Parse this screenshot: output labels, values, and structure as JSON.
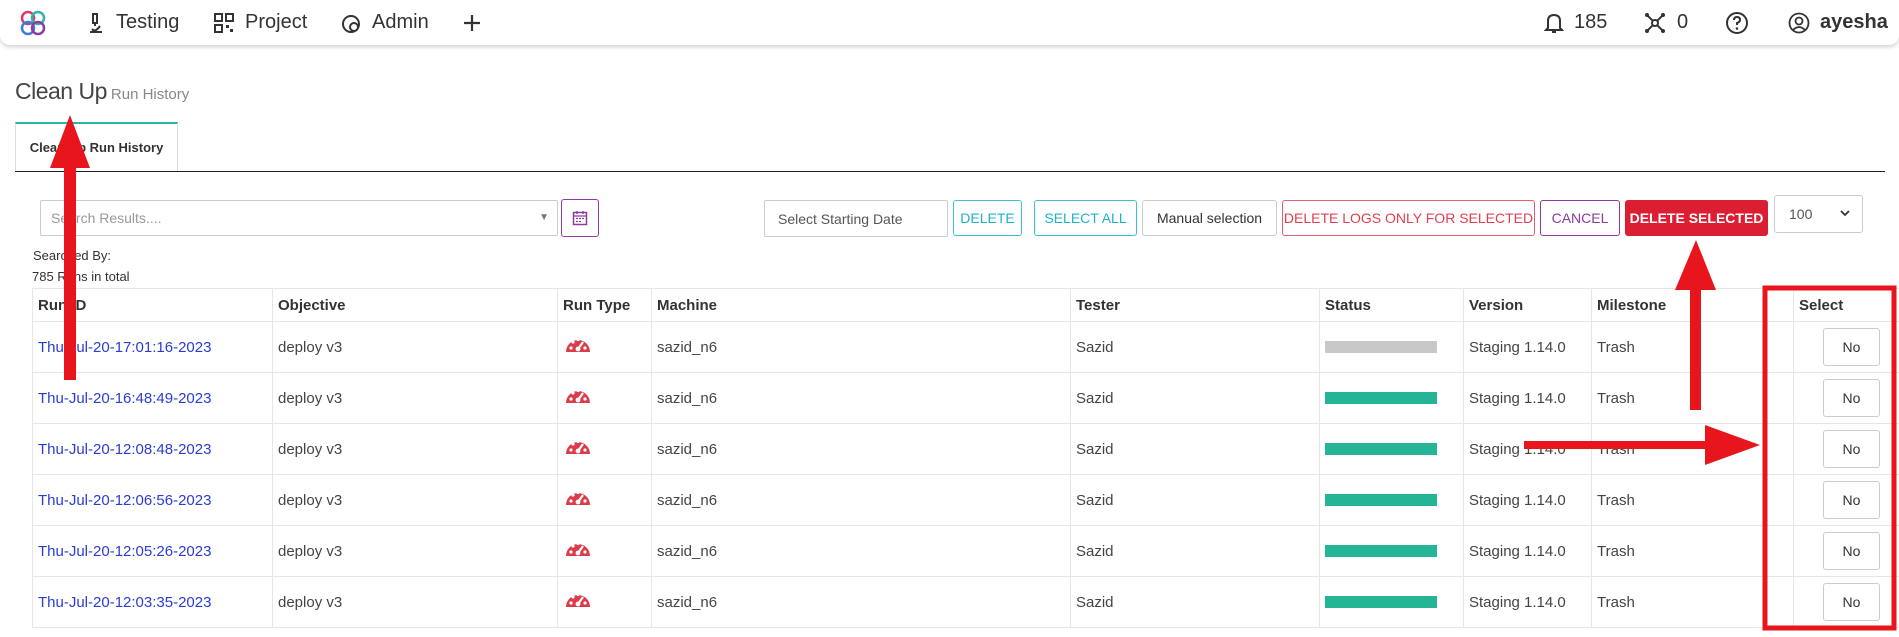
{
  "nav": {
    "items": [
      {
        "label": "Testing",
        "icon": "microscope-icon"
      },
      {
        "label": "Project",
        "icon": "qr-grid-icon"
      },
      {
        "label": "Admin",
        "icon": "gear-shield-icon"
      }
    ],
    "notifications_count": "185",
    "graph_count": "0",
    "username": "ayesha"
  },
  "page": {
    "title": "Clean Up",
    "subtitle": "Run History",
    "tab_label": "Clean Up Run History"
  },
  "toolbar": {
    "search_placeholder": "Search Results....",
    "date_placeholder": "Select Starting Date",
    "delete_label": "DELETE",
    "select_all_label": "SELECT ALL",
    "manual_selection_label": "Manual selection",
    "delete_logs_label": "DELETE LOGS ONLY FOR SELECTED",
    "cancel_label": "CANCEL",
    "delete_selected_label": "DELETE SELECTED",
    "page_size": "100"
  },
  "summary": {
    "searched_by": "Searched By:",
    "total": "785 Runs in total"
  },
  "table": {
    "columns": [
      "Run ID",
      "Objective",
      "Run Type",
      "Machine",
      "Tester",
      "Status",
      "Version",
      "Milestone",
      "Select"
    ],
    "rows": [
      {
        "run_id": "Thu-Jul-20-17:01:16-2023",
        "objective": "deploy v3",
        "machine": "sazid_n6",
        "tester": "Sazid",
        "status": "in-progress",
        "status_color": "#c8c8c8",
        "version": "Staging 1.14.0",
        "milestone": "Trash",
        "select": "No"
      },
      {
        "run_id": "Thu-Jul-20-16:48:49-2023",
        "objective": "deploy v3",
        "machine": "sazid_n6",
        "tester": "Sazid",
        "status": "passed",
        "status_color": "#26b496",
        "version": "Staging 1.14.0",
        "milestone": "Trash",
        "select": "No"
      },
      {
        "run_id": "Thu-Jul-20-12:08:48-2023",
        "objective": "deploy v3",
        "machine": "sazid_n6",
        "tester": "Sazid",
        "status": "passed",
        "status_color": "#26b496",
        "version": "Staging 1.14.0",
        "milestone": "Trash",
        "select": "No"
      },
      {
        "run_id": "Thu-Jul-20-12:06:56-2023",
        "objective": "deploy v3",
        "machine": "sazid_n6",
        "tester": "Sazid",
        "status": "passed",
        "status_color": "#26b496",
        "version": "Staging 1.14.0",
        "milestone": "Trash",
        "select": "No"
      },
      {
        "run_id": "Thu-Jul-20-12:05:26-2023",
        "objective": "deploy v3",
        "machine": "sazid_n6",
        "tester": "Sazid",
        "status": "passed",
        "status_color": "#26b496",
        "version": "Staging 1.14.0",
        "milestone": "Trash",
        "select": "No"
      },
      {
        "run_id": "Thu-Jul-20-12:03:35-2023",
        "objective": "deploy v3",
        "machine": "sazid_n6",
        "tester": "Sazid",
        "status": "passed",
        "status_color": "#26b496",
        "version": "Staging 1.14.0",
        "milestone": "Trash",
        "select": "No"
      }
    ]
  },
  "colors": {
    "accent_teal": "#2ab7a9",
    "danger": "#dc1e33",
    "link": "#2a3cd4",
    "purple": "#8b3c9c",
    "annotation_red": "#e8161c"
  }
}
